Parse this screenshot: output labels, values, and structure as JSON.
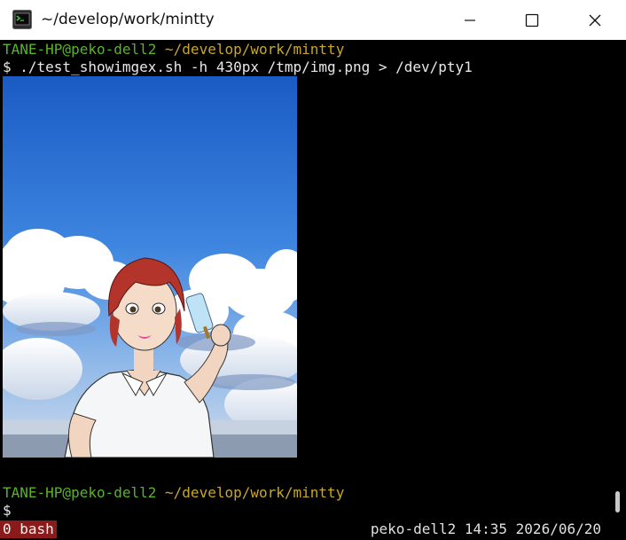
{
  "window": {
    "title": "~/develop/work/mintty",
    "app_icon": "terminal-icon",
    "controls": [
      "minimize-icon",
      "maximize-icon",
      "close-icon"
    ]
  },
  "terminal": {
    "prompt1": {
      "user_host": "TANE-HP@peko-dell2",
      "path": "~/develop/work/mintty"
    },
    "command_line": "$ ./test_showimgex.sh -h 430px /tmp/img.png > /dev/pty1",
    "image": {
      "description_icon": "anime-girl-with-popsicle-image"
    },
    "prompt2": {
      "user_host": "TANE-HP@peko-dell2",
      "path": "~/develop/work/mintty"
    },
    "prompt_symbol": "$"
  },
  "statusbar": {
    "window_label": "0 bash",
    "right_text": "peko-dell2 14:35 2026/06/20"
  },
  "colors": {
    "prompt_green": "#59b32b",
    "prompt_yellow": "#c9a72a",
    "status_red": "#8b1b1b",
    "background": "#000000"
  }
}
